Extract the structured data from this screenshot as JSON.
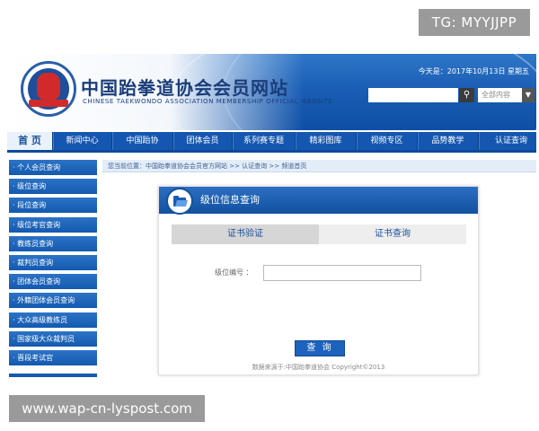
{
  "watermarks": {
    "top": "TG: MYYJJPP",
    "bottom": "www.wap-cn-lyspost.com"
  },
  "header": {
    "title": "中国跆拳道协会会员网站",
    "subtitle": "CHINESE TAEKWONDO ASSOCIATION MEMBERSHIP OFFICIAL WEBSITE",
    "date_line": "今天是：2017年10月13日 星期五",
    "search_placeholder": "",
    "search_select": "全部内容",
    "logo_icon": "taekwondo-association-logo"
  },
  "nav": {
    "items": [
      "首 页",
      "新闻中心",
      "中国跆协",
      "团体会员",
      "系列赛专题",
      "精彩图库",
      "视频专区",
      "品势教学",
      "认证查询"
    ]
  },
  "sidebar": {
    "items": [
      "· 个人会员查询",
      "· 级位查询",
      "· 段位查询",
      "· 级位考官查询",
      "· 教练员查询",
      "· 裁判员查询",
      "· 团体会员查询",
      "· 外籍团体会员查询",
      "· 大众高级教练员",
      "· 国家级大众裁判员",
      "· 晋段考试官"
    ]
  },
  "breadcrumb": "您当前位置：中国跆拳道协会会员官方网站 >> 认证查询 >> 频道首页",
  "panel": {
    "title": "级位信息查询",
    "tabs": [
      "证书验证",
      "证书查询"
    ],
    "field_label": "级位编号 ：",
    "field_value": "",
    "query_button": "查 询",
    "source_note": "数据来源于:中国跆拳道协会 Copyright©2013"
  },
  "colors": {
    "brand_blue": "#1557b0",
    "light_blue": "#e3edf8"
  }
}
